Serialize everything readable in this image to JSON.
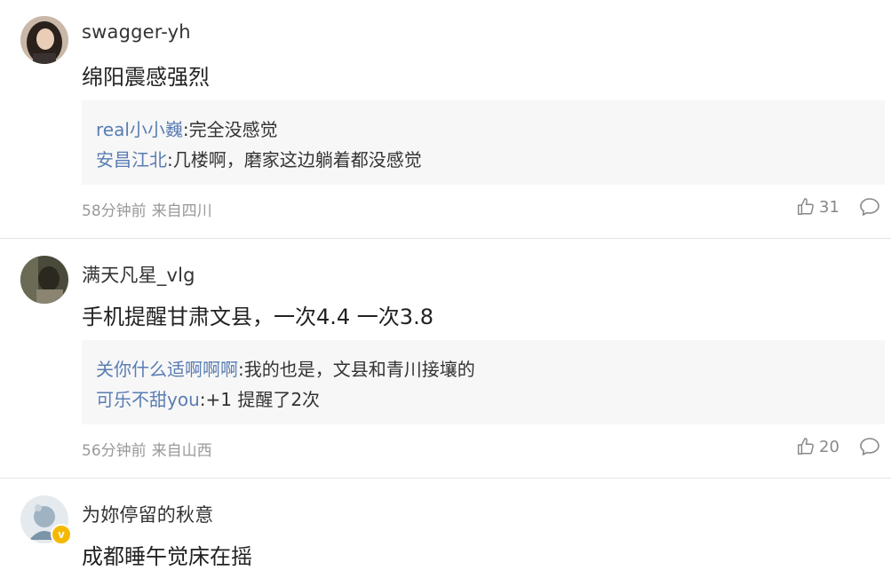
{
  "comments": [
    {
      "username": "swagger-yh",
      "text": "绵阳震感强烈",
      "replies": [
        {
          "name": "real小小巍",
          "text": ":完全没感觉"
        },
        {
          "name": "安昌江北",
          "text": ":几楼啊，磨家这边躺着都没感觉"
        }
      ],
      "time": "58分钟前",
      "location": "来自四川",
      "likes": "31"
    },
    {
      "username": "满天凡星_vlg",
      "text": "手机提醒甘肃文县，一次4.4 一次3.8",
      "replies": [
        {
          "name": "关你什么适啊啊啊",
          "text": ":我的也是，文县和青川接壤的"
        },
        {
          "name": "可乐不甜you",
          "text": ":+1 提醒了2次"
        }
      ],
      "time": "56分钟前",
      "location": "来自山西",
      "likes": "20"
    },
    {
      "username": "为妳停留的秋意",
      "text": "成都睡午觉床在摇",
      "verified_badge": "v"
    }
  ],
  "colors": {
    "reply_name": "#5a7db3",
    "meta": "#999999",
    "reply_bg": "#f7f7f7",
    "badge": "#f5b800"
  }
}
